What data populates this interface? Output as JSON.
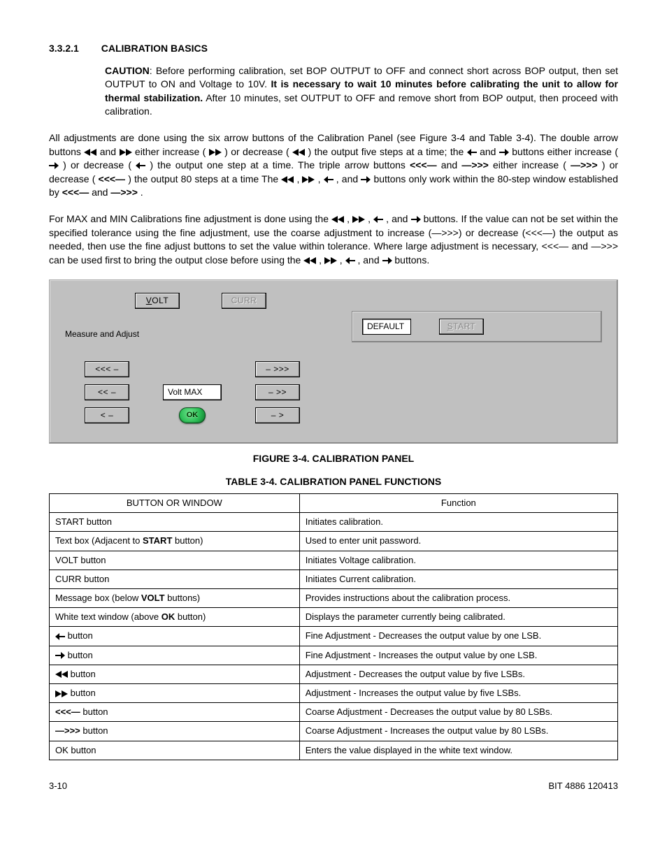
{
  "heading": {
    "num": "3.3.2.1",
    "title": "CALIBRATION BASICS"
  },
  "caution": {
    "label": "CAUTION",
    "pre": ": Before performing calibration, set BOP OUTPUT to OFF and connect short across BOP output, then set OUTPUT to ON and Voltage to 10V. ",
    "bold": "It is necessary to wait 10 minutes before calibrating the unit to allow for thermal stabilization.",
    "post": " After 10 minutes, set OUTPUT to OFF and remove short from BOP output, then proceed with calibration."
  },
  "para1": {
    "p1": "All adjustments are done using the six arrow buttons of the Calibration Panel (see Figure 3-4 and Table 3-4). The double arrow buttons ",
    "p2": " and ",
    "p3": " either increase ( ",
    "p4": " ) or decrease ( ",
    "p5": " ) the output five steps at a time; the ",
    "p6": " and ",
    "p7": " buttons either increase (",
    "p8": ") or decrease (",
    "p9": ") the output one step at a time. The triple arrow buttons ",
    "p10_b": "<<<—",
    "p11": " and ",
    "p12_b": "—>>>",
    "p13": " either increase (",
    "p14_b": "—>>>",
    "p15": ") or decrease (",
    "p16_b": "<<<—",
    "p17": ") the output 80 steps at a time The ",
    "p18": ", ",
    "p19": ", ",
    "p20": ", and ",
    "p21": " buttons only work within the 80-step window established by ",
    "p22_b": "<<<—",
    "p23": " and ",
    "p24_b": "—>>>",
    "p25": "."
  },
  "para2": {
    "p1": "For MAX and MIN Calibrations fine adjustment is done using the ",
    "p2": ", ",
    "p3": ", ",
    "p4": ", and ",
    "p5": " buttons. If the value can not be set within the specified tolerance using the fine adjustment, use the coarse adjustment to increase (—>>>) or decrease (<<<—) the output as needed, then use the fine adjust buttons to set the value within tolerance. Where large adjustment is necessary, <<<— and —>>> can be used first to bring the output close before using the ",
    "p6": ", ",
    "p7": ", ",
    "p8": ", and ",
    "p9": " buttons."
  },
  "panel": {
    "volt": "VOLT",
    "curr": "CURR",
    "msg": "Measure and Adjust",
    "tripleL": "<<< –",
    "tripleR": "– >>>",
    "dblL": "<< –",
    "dblR": "– >>",
    "oneL": "< –",
    "oneR": "– >",
    "paramLabel": "Volt MAX",
    "ok": "OK",
    "default": "DEFAULT",
    "start": "START"
  },
  "figCaption": "FIGURE 3-4.   CALIBRATION PANEL",
  "tblCaption": "TABLE 3-4.  CALIBRATION PANEL FUNCTIONS",
  "tableHeaders": {
    "col1": "BUTTON OR WINDOW",
    "col2": "Function"
  },
  "table": [
    {
      "c1_pre": "START button",
      "c1_bold": "",
      "c1_post": "",
      "c2": "Initiates calibration."
    },
    {
      "c1_pre": "Text box (Adjacent to ",
      "c1_bold": "START",
      "c1_post": " button)",
      "c2": "Used to enter unit password."
    },
    {
      "c1_pre": "VOLT button",
      "c1_bold": "",
      "c1_post": "",
      "c2": "Initiates Voltage calibration."
    },
    {
      "c1_pre": "CURR button",
      "c1_bold": "",
      "c1_post": "",
      "c2": "Initiates Current calibration."
    },
    {
      "c1_pre": "Message box (below ",
      "c1_bold": "VOLT",
      "c1_post": " buttons)",
      "c2": "Provides instructions about the calibration process."
    },
    {
      "c1_pre": "White text window (above ",
      "c1_bold": "OK",
      "c1_post": " button)",
      "c2": "Displays the parameter currently being calibrated."
    },
    {
      "c1_pre": "",
      "c1_bold": "",
      "c1_post": "",
      "icon": "left1",
      "tail": " button",
      "c2": "Fine Adjustment - Decreases the output value by one LSB."
    },
    {
      "c1_pre": "",
      "c1_bold": "",
      "c1_post": "",
      "icon": "right1",
      "tail": " button",
      "c2": "Fine Adjustment - Increases the output value by one LSB."
    },
    {
      "c1_pre": "",
      "c1_bold": "",
      "c1_post": "",
      "icon": "left2",
      "tail": "   button",
      "c2": "Adjustment - Decreases the output value by five LSBs."
    },
    {
      "c1_pre": "",
      "c1_bold": "",
      "c1_post": "",
      "icon": "right2",
      "tail": "   button",
      "c2": "Adjustment - Increases the output value by five LSBs."
    },
    {
      "c1_pre": "",
      "c1_bold": "<<<—",
      "c1_post": " button",
      "c2": "Coarse Adjustment - Decreases the output value by 80 LSBs."
    },
    {
      "c1_pre": "",
      "c1_bold": "—>>>",
      "c1_post": " button",
      "c2": "Coarse Adjustment - Increases the output value by 80 LSBs."
    },
    {
      "c1_pre": "OK button",
      "c1_bold": "",
      "c1_post": "",
      "c2": "Enters the value displayed in the white text window."
    }
  ],
  "footer": {
    "left": "3-10",
    "right": "BIT 4886 120413"
  }
}
